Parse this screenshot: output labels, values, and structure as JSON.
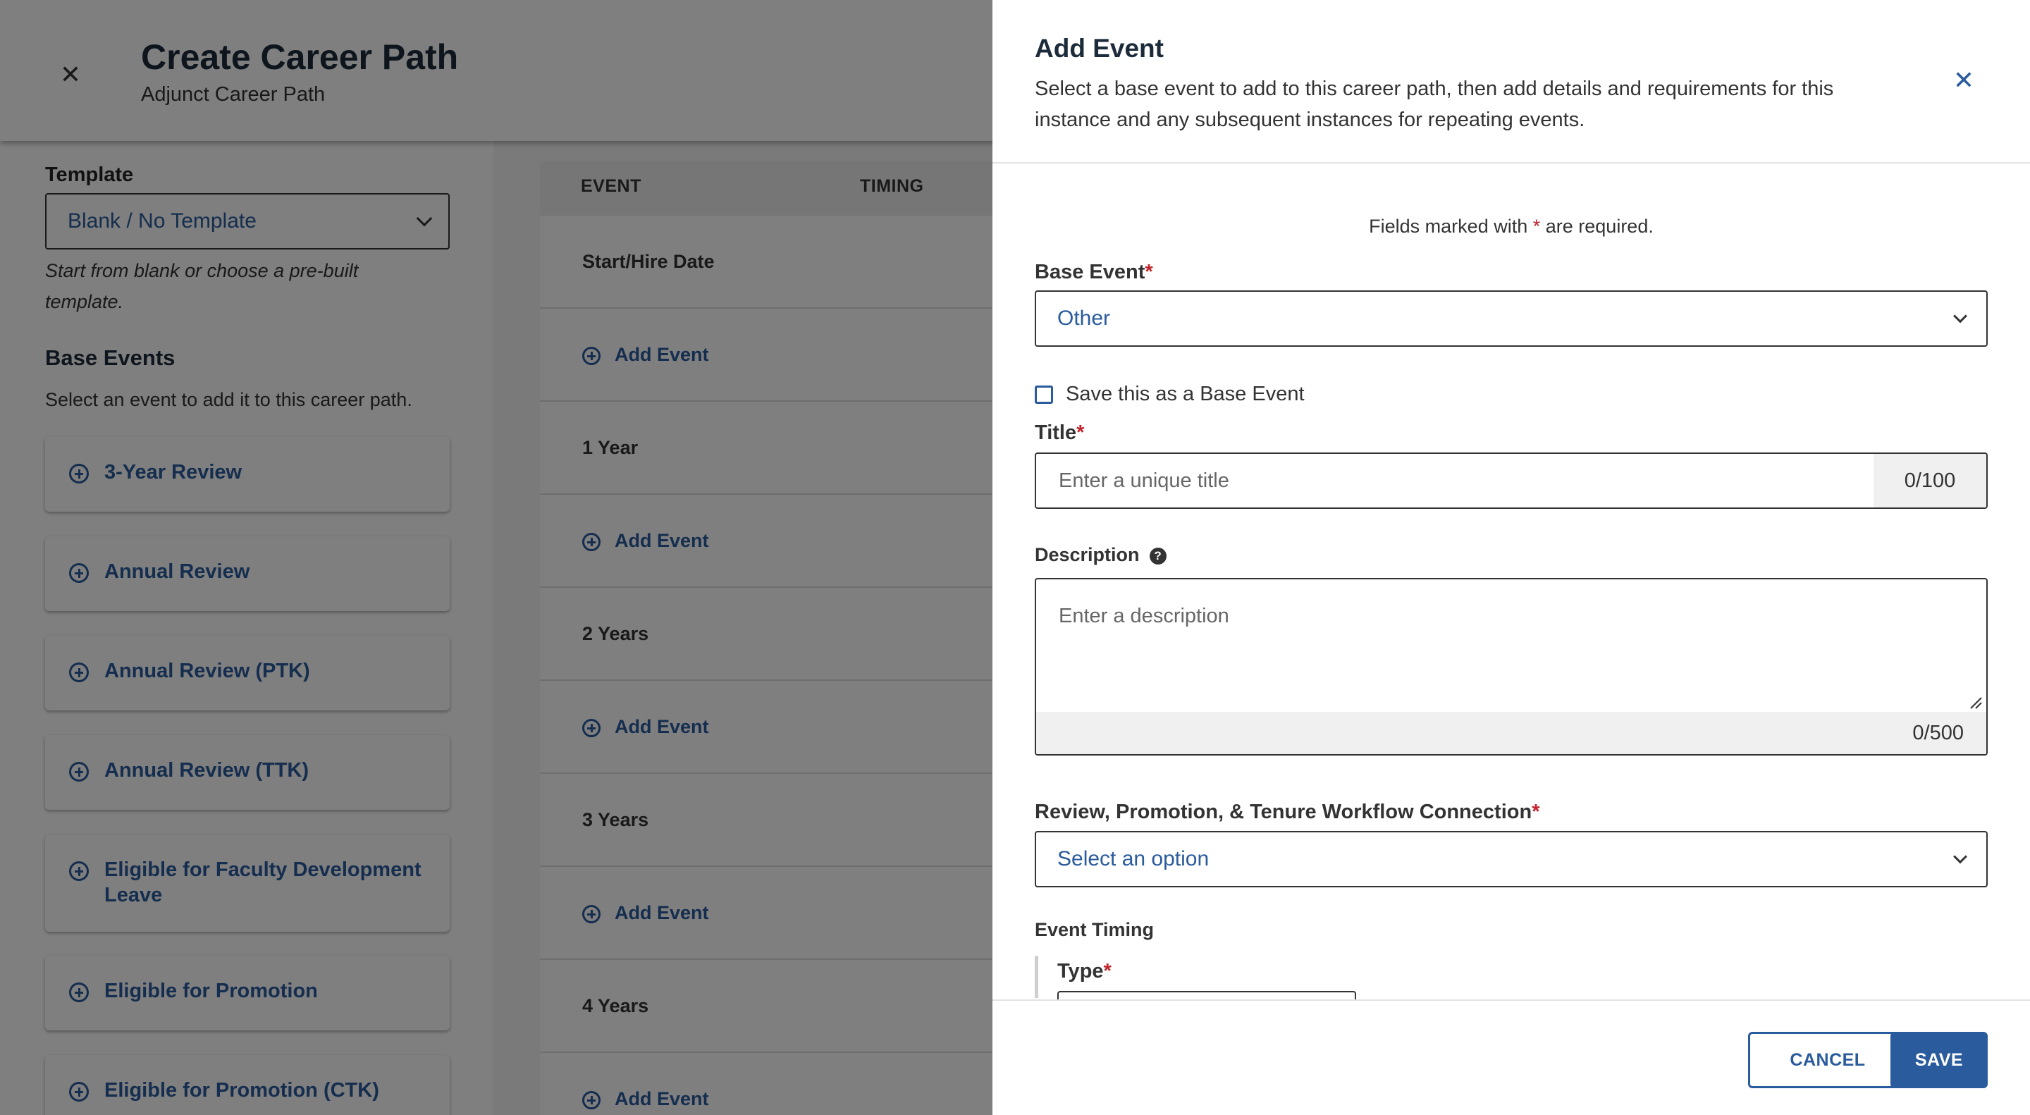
{
  "header": {
    "title": "Create Career Path",
    "subtitle": "Adjunct Career Path",
    "close_icon": "close-icon"
  },
  "left_panel": {
    "template_label": "Template",
    "template_value": "Blank / No Template",
    "template_hint": "Start from blank or choose a pre-built template.",
    "base_events_title": "Base Events",
    "base_events_desc": "Select an event to add it to this career path.",
    "items": [
      {
        "label": "3-Year Review"
      },
      {
        "label": "Annual Review"
      },
      {
        "label": "Annual Review (PTK)"
      },
      {
        "label": "Annual Review (TTK)"
      },
      {
        "label": "Eligible for Faculty Development Leave"
      },
      {
        "label": "Eligible for Promotion"
      },
      {
        "label": "Eligible for Promotion (CTK)"
      }
    ]
  },
  "timeline": {
    "columns": [
      "EVENT",
      "TIMING"
    ],
    "rows": [
      {
        "type": "milestone",
        "label": "Start/Hire Date"
      },
      {
        "type": "add",
        "label": "Add Event"
      },
      {
        "type": "milestone",
        "label": "1 Year"
      },
      {
        "type": "add",
        "label": "Add Event"
      },
      {
        "type": "milestone",
        "label": "2 Years"
      },
      {
        "type": "add",
        "label": "Add Event"
      },
      {
        "type": "milestone",
        "label": "3 Years"
      },
      {
        "type": "add",
        "label": "Add Event"
      },
      {
        "type": "milestone",
        "label": "4 Years"
      },
      {
        "type": "add",
        "label": "Add Event"
      }
    ]
  },
  "drawer": {
    "title": "Add Event",
    "description": "Select a base event to add to this career path, then add details and requirements for this instance and any subsequent instances for repeating events.",
    "required_note_pre": "Fields marked with ",
    "required_star": "*",
    "required_note_post": " are required.",
    "base_event_label": "Base Event",
    "base_event_value": "Other",
    "save_as_base_label": "Save this as a Base Event",
    "title_label": "Title",
    "title_placeholder": "Enter a unique title",
    "title_counter": "0/100",
    "description_label": "Description",
    "description_placeholder": "Enter a description",
    "description_counter": "0/500",
    "workflow_label": "Review, Promotion, & Tenure Workflow Connection",
    "workflow_value": "Select an option",
    "event_timing_label": "Event Timing",
    "type_label": "Type",
    "cancel_label": "CANCEL",
    "save_label": "SAVE"
  },
  "colors": {
    "accent": "#2a5b9c",
    "required": "#c0232b",
    "overlay": "rgba(0,0,0,0.5)"
  }
}
